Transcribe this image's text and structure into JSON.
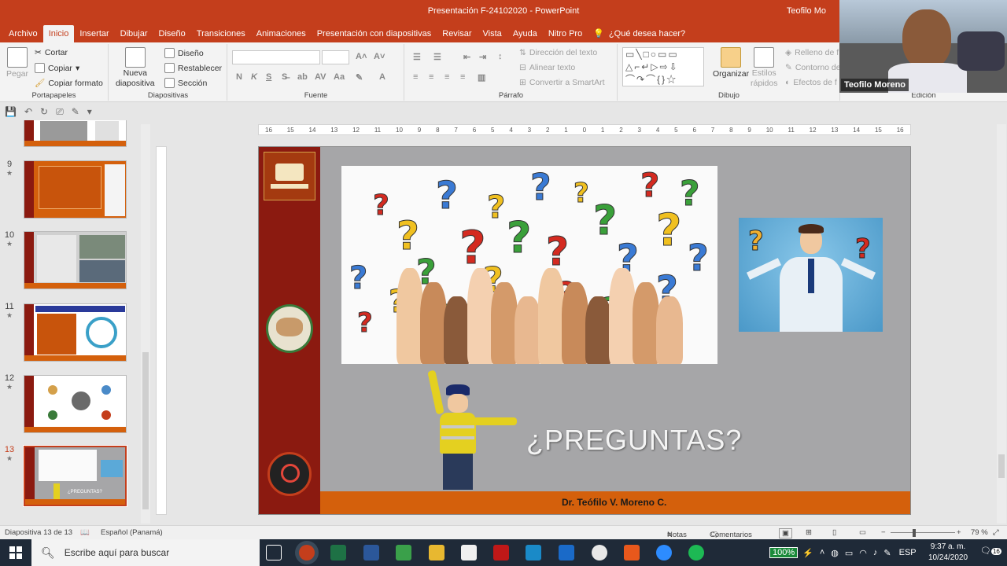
{
  "window": {
    "title": "Presentación F-24102020  -  PowerPoint",
    "user": "Teofilo Mo"
  },
  "tabs": [
    "Archivo",
    "Inicio",
    "Insertar",
    "Dibujar",
    "Diseño",
    "Transiciones",
    "Animaciones",
    "Presentación con diapositivas",
    "Revisar",
    "Vista",
    "Ayuda",
    "Nitro Pro"
  ],
  "tell_me": "¿Qué desea hacer?",
  "ribbon": {
    "clipboard": {
      "paste": "Pegar",
      "cut": "Cortar",
      "copy": "Copiar",
      "format_painter": "Copiar formato",
      "label": "Portapapeles"
    },
    "slides": {
      "new_slide_1": "Nueva",
      "new_slide_2": "diapositiva",
      "layout": "Diseño",
      "reset": "Restablecer",
      "section": "Sección",
      "label": "Diapositivas"
    },
    "font": {
      "label": "Fuente",
      "bold": "N",
      "italic": "K",
      "underline": "S"
    },
    "paragraph": {
      "text_direction": "Dirección del texto",
      "align_text": "Alinear texto",
      "smartart": "Convertir a SmartArt",
      "label": "Párrafo"
    },
    "drawing": {
      "arrange": "Organizar",
      "quick_styles_1": "Estilos",
      "quick_styles_2": "rápidos",
      "fill": "Relleno de f",
      "outline": "Contorno de",
      "effects": "Efectos de f",
      "label": "Dibujo"
    },
    "editing": {
      "label": "Edición"
    }
  },
  "ruler_ticks": [
    "16",
    "15",
    "14",
    "13",
    "12",
    "11",
    "10",
    "9",
    "8",
    "7",
    "6",
    "5",
    "4",
    "3",
    "2",
    "1",
    "0",
    "1",
    "2",
    "3",
    "4",
    "5",
    "6",
    "7",
    "8",
    "9",
    "10",
    "11",
    "12",
    "13",
    "14",
    "15",
    "16"
  ],
  "thumbnails": [
    {
      "num": "",
      "star": ""
    },
    {
      "num": "9",
      "star": "★"
    },
    {
      "num": "10",
      "star": "★"
    },
    {
      "num": "11",
      "star": "★"
    },
    {
      "num": "12",
      "star": "★"
    },
    {
      "num": "13",
      "star": "★"
    }
  ],
  "slide": {
    "title": "¿PREGUNTAS?",
    "author": "Dr.  Teófilo V. Moreno C.",
    "thumb_text": "¿PREGUNTAS?"
  },
  "webcam": {
    "name": "Teofilo Moreno"
  },
  "status": {
    "slide_count": "Diapositiva 13 de 13",
    "language": "Español (Panamá)",
    "notes": "Notas",
    "comments": "Comentarios",
    "zoom": "79 %"
  },
  "taskbar": {
    "search_placeholder": "Escribe aquí para buscar",
    "battery": "100%",
    "lang": "ESP",
    "time": "9:37 a. m.",
    "date": "10/24/2020",
    "notifications": "16"
  },
  "colors": {
    "accent": "#c43e1c",
    "slide_band": "#8b1a10",
    "slide_footer": "#d4600c",
    "slide_bg": "#a6a6a8"
  }
}
